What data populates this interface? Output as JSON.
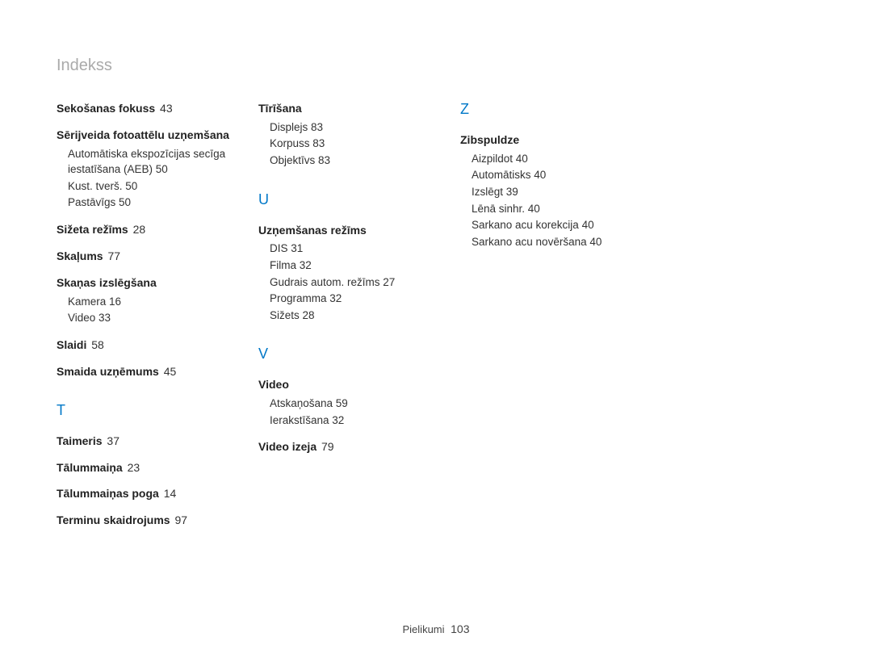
{
  "header": "Indekss",
  "footer": {
    "label": "Pielikumi",
    "page": "103"
  },
  "columns": [
    {
      "blocks": [
        {
          "type": "entry",
          "term": "Sekošanas fokuss",
          "page": "43"
        },
        {
          "type": "entry",
          "term": "Sērijveida fotoattēlu uzņemšana",
          "subs": [
            {
              "label": "Automātiska ekspozīcijas secīga iestatīšana (AEB)",
              "page": "50"
            },
            {
              "label": "Kust. tverš.",
              "page": "50"
            },
            {
              "label": "Pastāvīgs",
              "page": "50"
            }
          ]
        },
        {
          "type": "entry",
          "term": "Sižeta režīms",
          "page": "28"
        },
        {
          "type": "entry",
          "term": "Skaļums",
          "page": "77"
        },
        {
          "type": "entry",
          "term": "Skaņas izslēgšana",
          "subs": [
            {
              "label": "Kamera",
              "page": "16"
            },
            {
              "label": "Video",
              "page": "33"
            }
          ]
        },
        {
          "type": "entry",
          "term": "Slaidi",
          "page": "58"
        },
        {
          "type": "entry",
          "term": "Smaida uzņēmums",
          "page": "45"
        },
        {
          "type": "letter",
          "text": "T"
        },
        {
          "type": "entry",
          "term": "Taimeris",
          "page": "37"
        },
        {
          "type": "entry",
          "term": "Tālummaiņa",
          "page": "23"
        },
        {
          "type": "entry",
          "term": "Tālummaiņas poga",
          "page": "14"
        },
        {
          "type": "entry",
          "term": "Terminu skaidrojums",
          "page": "97"
        }
      ]
    },
    {
      "blocks": [
        {
          "type": "entry",
          "term": "Tīrīšana",
          "subs": [
            {
              "label": "Displejs",
              "page": "83"
            },
            {
              "label": "Korpuss",
              "page": "83"
            },
            {
              "label": "Objektīvs",
              "page": "83"
            }
          ]
        },
        {
          "type": "letter",
          "text": "U"
        },
        {
          "type": "entry",
          "term": "Uzņemšanas režīms",
          "subs": [
            {
              "label": "DIS",
              "page": "31"
            },
            {
              "label": "Filma",
              "page": "32"
            },
            {
              "label": "Gudrais autom. režīms",
              "page": "27"
            },
            {
              "label": "Programma",
              "page": "32"
            },
            {
              "label": "Sižets",
              "page": "28"
            }
          ]
        },
        {
          "type": "letter",
          "text": "V"
        },
        {
          "type": "entry",
          "term": "Video",
          "subs": [
            {
              "label": "Atskaņošana",
              "page": "59"
            },
            {
              "label": "Ierakstīšana",
              "page": "32"
            }
          ]
        },
        {
          "type": "entry",
          "term": "Video izeja",
          "page": "79"
        }
      ]
    },
    {
      "blocks": [
        {
          "type": "letter",
          "text": "Z",
          "nomargin": true
        },
        {
          "type": "entry",
          "term": "Zibspuldze",
          "subs": [
            {
              "label": "Aizpildot",
              "page": "40"
            },
            {
              "label": "Automātisks",
              "page": "40"
            },
            {
              "label": "Izslēgt",
              "page": "39"
            },
            {
              "label": "Lēnā sinhr.",
              "page": "40"
            },
            {
              "label": "Sarkano acu korekcija",
              "page": "40"
            },
            {
              "label": "Sarkano acu novēršana",
              "page": "40"
            }
          ]
        }
      ]
    }
  ]
}
